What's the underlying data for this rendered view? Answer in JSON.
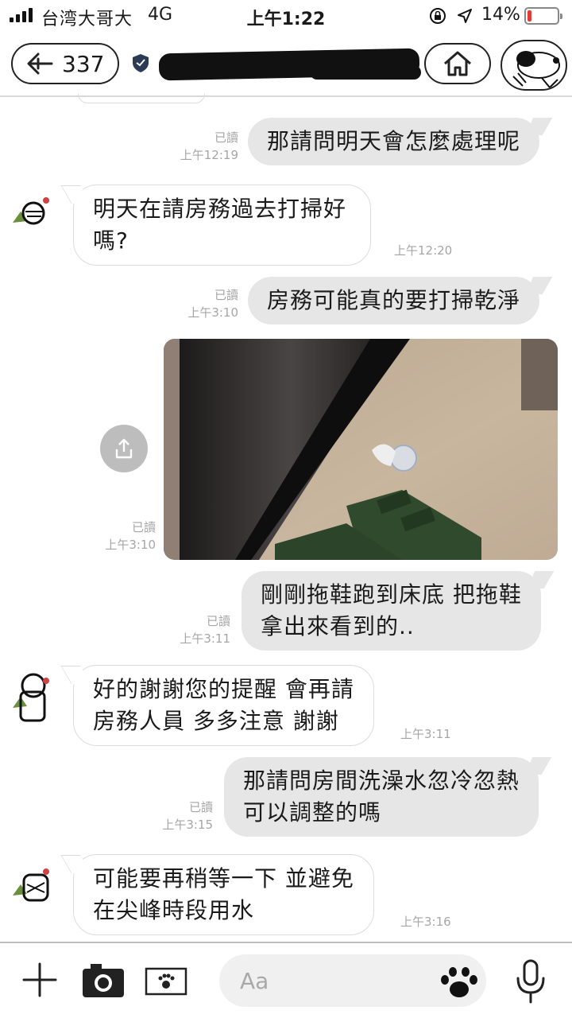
{
  "status": {
    "carrier": "台湾大哥大",
    "network": "4G",
    "time": "上午1:22",
    "battery_pct": "14%",
    "battery_level": 0.14,
    "battery_color": "#e53935"
  },
  "header": {
    "back_count": "337",
    "icons": [
      "back-arrow-icon",
      "verified-shield-icon",
      "home-icon",
      "snoopy-avatar"
    ]
  },
  "messages": [
    {
      "dir": "out",
      "read": "已讀",
      "time": "上午12:19",
      "text": "那請問明天會怎麼處理呢"
    },
    {
      "dir": "in",
      "time": "上午12:20",
      "lines": [
        "明天在請房務過去打掃好",
        "嗎?"
      ]
    },
    {
      "dir": "out",
      "read": "已讀",
      "time": "上午3:10",
      "text": "房務可能真的要打掃乾淨"
    },
    {
      "dir": "out",
      "type": "image",
      "read": "已讀",
      "time": "上午3:10"
    },
    {
      "dir": "out",
      "read": "已讀",
      "time": "上午3:11",
      "lines": [
        "剛剛拖鞋跑到床底 把拖鞋",
        "拿出來看到的.."
      ]
    },
    {
      "dir": "in",
      "time": "上午3:11",
      "lines": [
        "好的謝謝您的提醒 會再請",
        "房務人員 多多注意 謝謝"
      ]
    },
    {
      "dir": "out",
      "read": "已讀",
      "time": "上午3:15",
      "lines": [
        "那請問房間洗澡水忽冷忽熱",
        "可以調整的嗎"
      ]
    },
    {
      "dir": "in",
      "time": "上午3:16",
      "lines": [
        "可能要再稍等一下 並避免",
        "在尖峰時段用水"
      ]
    }
  ],
  "input": {
    "placeholder": "Aa"
  },
  "colors": {
    "bubble_out": "#e6e6e6",
    "bubble_in": "#ffffff",
    "meta": "#a6a6a6"
  }
}
